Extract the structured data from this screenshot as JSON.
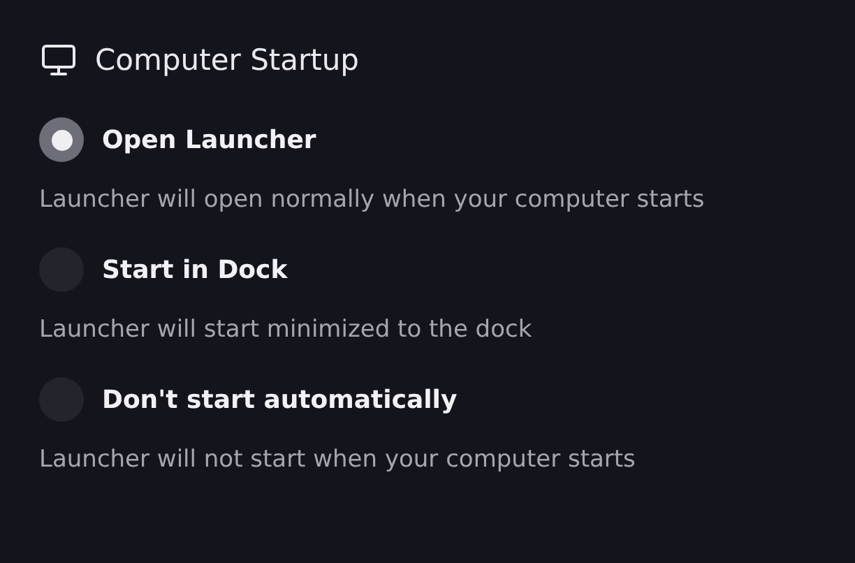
{
  "section": {
    "title": "Computer Startup"
  },
  "options": [
    {
      "label": "Open Launcher",
      "description": "Launcher will open normally when your computer starts",
      "selected": true
    },
    {
      "label": "Start in Dock",
      "description": "Launcher will start minimized to the dock",
      "selected": false
    },
    {
      "label": "Don't start automatically",
      "description": "Launcher will not start when your computer starts",
      "selected": false
    }
  ]
}
